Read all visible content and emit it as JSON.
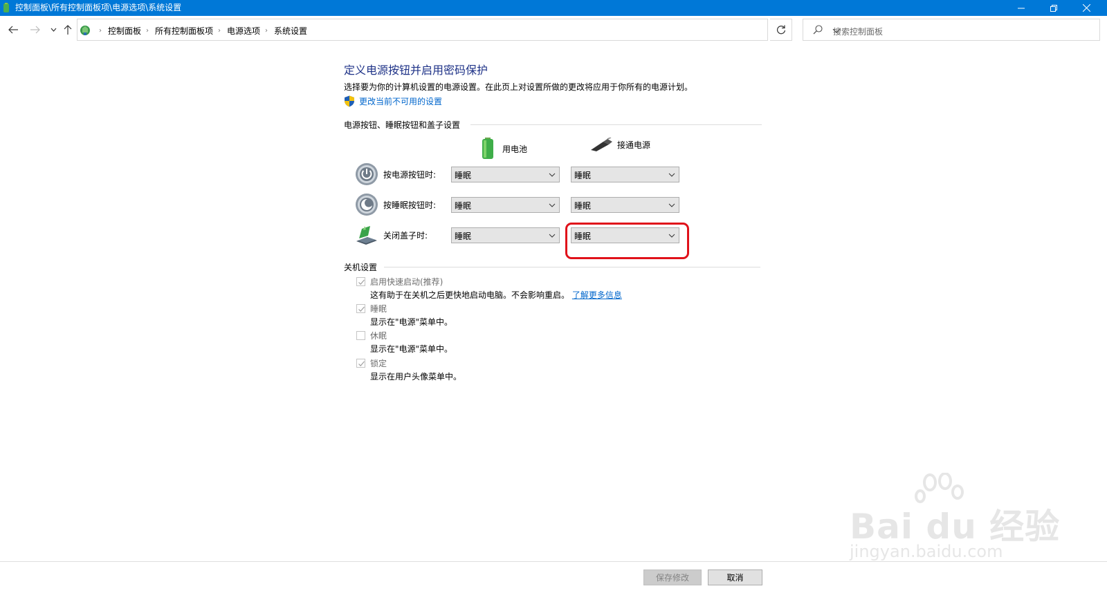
{
  "window": {
    "title": "控制面板\\所有控制面板项\\电源选项\\系统设置"
  },
  "nav": {
    "breadcrumbs": [
      "控制面板",
      "所有控制面板项",
      "电源选项",
      "系统设置"
    ],
    "search_placeholder": "搜索控制面板"
  },
  "main": {
    "title": "定义电源按钮并启用密码保护",
    "description": "选择要为你的计算机设置的电源设置。在此页上对设置所做的更改将应用于你所有的电源计划。",
    "admin_link": "更改当前不可用的设置",
    "section_buttons": "电源按钮、睡眠按钮和盖子设置",
    "column_battery": "用电池",
    "column_plugged": "接通电源",
    "rows": [
      {
        "label": "按电源按钮时:",
        "battery": "睡眠",
        "plugged": "睡眠"
      },
      {
        "label": "按睡眠按钮时:",
        "battery": "睡眠",
        "plugged": "睡眠"
      },
      {
        "label": "关闭盖子时:",
        "battery": "睡眠",
        "plugged": "睡眠"
      }
    ],
    "section_shutdown": "关机设置",
    "shutdown_options": [
      {
        "label": "启用快速启动(推荐)",
        "checked": true,
        "desc": "这有助于在关机之后更快地启动电脑。不会影响重启。",
        "link": "了解更多信息"
      },
      {
        "label": "睡眠",
        "checked": true,
        "desc": "显示在\"电源\"菜单中。"
      },
      {
        "label": "休眠",
        "checked": false,
        "desc": "显示在\"电源\"菜单中。"
      },
      {
        "label": "锁定",
        "checked": true,
        "desc": "显示在用户头像菜单中。"
      }
    ]
  },
  "footer": {
    "save_label": "保存修改",
    "cancel_label": "取消"
  },
  "watermark": {
    "brand": "Bai du 经验",
    "url": "jingyan.baidu.com"
  },
  "colors": {
    "titlebar": "#0078d7",
    "heading": "#1e3287",
    "link": "#0066cc",
    "highlight": "#e0111a"
  }
}
